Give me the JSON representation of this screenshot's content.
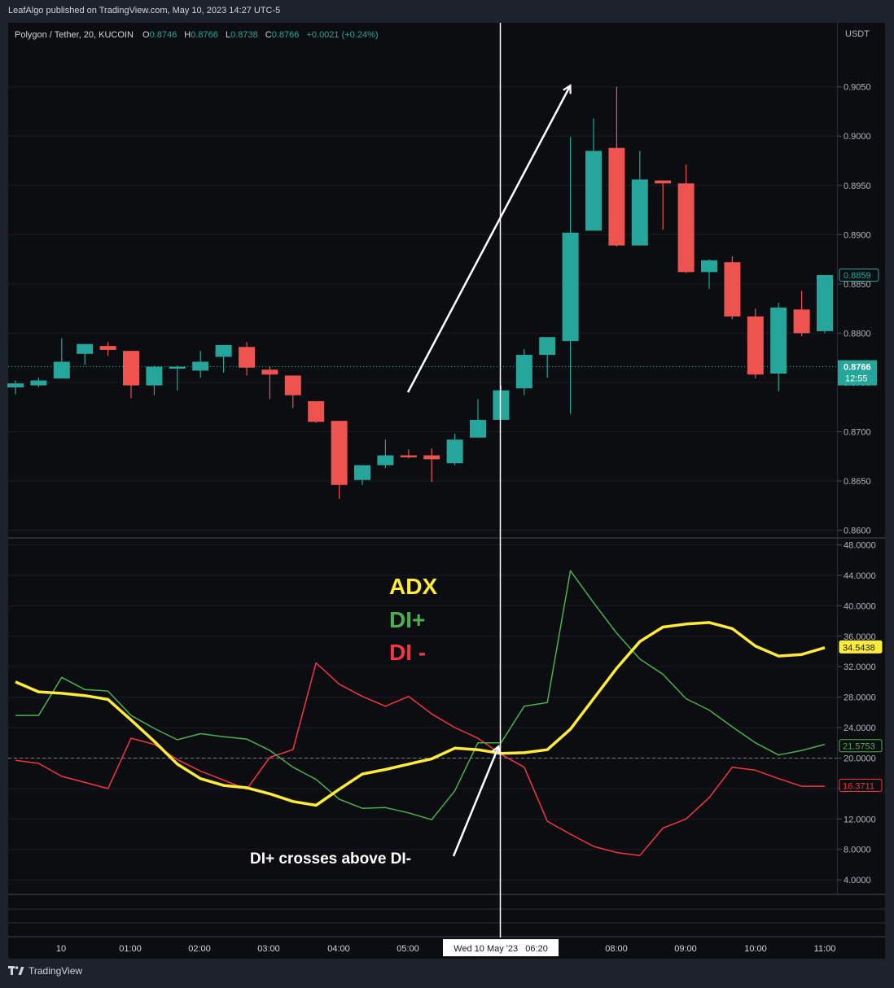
{
  "header": {
    "published": "LeafAlgo published on TradingView.com, May 10, 2023 14:27 UTC-5"
  },
  "footer": {
    "brand": "TradingView"
  },
  "colors": {
    "up": "#26a69a",
    "down": "#ef5350",
    "adx": "#ffeb3b",
    "di_plus": "#4caf50",
    "di_minus": "#f23645",
    "bg": "#0c0d11",
    "axis_text": "#b2b5be"
  },
  "legend": {
    "symbol": "Polygon / Tether, 20, KUCOIN",
    "o_label": "O",
    "o": "0.8746",
    "h_label": "H",
    "h": "0.8766",
    "l_label": "L",
    "l": "0.8738",
    "c_label": "C",
    "c": "0.8766",
    "change": "+0.0021 (+0.24%)"
  },
  "annotations": {
    "adx": "ADX",
    "di_plus": "DI+",
    "di_minus": "DI -",
    "cross": "DI+ crosses above DI-"
  },
  "chart_data": [
    {
      "type": "candlestick",
      "currency": "USDT",
      "ylim": [
        0.8593,
        0.9115
      ],
      "y_ticks": [
        "0.8600",
        "0.8650",
        "0.8700",
        "0.8750",
        "0.8800",
        "0.8850",
        "0.8900",
        "0.8950",
        "0.9000",
        "0.9050"
      ],
      "last_price": "0.8766",
      "countdown": "12:55",
      "hi_price": "0.8859",
      "candles": [
        {
          "o": 0.8745,
          "h": 0.8752,
          "l": 0.8738,
          "c": 0.8749
        },
        {
          "o": 0.8747,
          "h": 0.8755,
          "l": 0.8745,
          "c": 0.8752
        },
        {
          "o": 0.8754,
          "h": 0.8795,
          "l": 0.8754,
          "c": 0.8771
        },
        {
          "o": 0.8779,
          "h": 0.8788,
          "l": 0.8768,
          "c": 0.8789
        },
        {
          "o": 0.8787,
          "h": 0.8791,
          "l": 0.8777,
          "c": 0.8783
        },
        {
          "o": 0.8782,
          "h": 0.8782,
          "l": 0.8734,
          "c": 0.8747
        },
        {
          "o": 0.8747,
          "h": 0.8767,
          "l": 0.8737,
          "c": 0.8766
        },
        {
          "o": 0.8764,
          "h": 0.8767,
          "l": 0.8742,
          "c": 0.8766
        },
        {
          "o": 0.8762,
          "h": 0.8782,
          "l": 0.8755,
          "c": 0.8771
        },
        {
          "o": 0.8776,
          "h": 0.8788,
          "l": 0.876,
          "c": 0.8788
        },
        {
          "o": 0.8786,
          "h": 0.8791,
          "l": 0.8757,
          "c": 0.8765
        },
        {
          "o": 0.8763,
          "h": 0.8766,
          "l": 0.8733,
          "c": 0.8758
        },
        {
          "o": 0.8757,
          "h": 0.8757,
          "l": 0.8724,
          "c": 0.8737
        },
        {
          "o": 0.8731,
          "h": 0.8731,
          "l": 0.8709,
          "c": 0.871
        },
        {
          "o": 0.8711,
          "h": 0.8711,
          "l": 0.8632,
          "c": 0.8646
        },
        {
          "o": 0.8651,
          "h": 0.8666,
          "l": 0.8646,
          "c": 0.8666
        },
        {
          "o": 0.8666,
          "h": 0.8692,
          "l": 0.8663,
          "c": 0.8676
        },
        {
          "o": 0.8676,
          "h": 0.8682,
          "l": 0.8673,
          "c": 0.8674
        },
        {
          "o": 0.8676,
          "h": 0.8683,
          "l": 0.8649,
          "c": 0.8672
        },
        {
          "o": 0.8668,
          "h": 0.8698,
          "l": 0.8666,
          "c": 0.8692
        },
        {
          "o": 0.8694,
          "h": 0.8733,
          "l": 0.8694,
          "c": 0.8712
        },
        {
          "o": 0.8712,
          "h": 0.8747,
          "l": 0.8712,
          "c": 0.8742
        },
        {
          "o": 0.8744,
          "h": 0.8784,
          "l": 0.8737,
          "c": 0.8778
        },
        {
          "o": 0.8778,
          "h": 0.8796,
          "l": 0.8755,
          "c": 0.8796
        },
        {
          "o": 0.8792,
          "h": 0.8999,
          "l": 0.8718,
          "c": 0.8902
        },
        {
          "o": 0.8904,
          "h": 0.9018,
          "l": 0.8904,
          "c": 0.8985
        },
        {
          "o": 0.8988,
          "h": 0.905,
          "l": 0.8888,
          "c": 0.8889
        },
        {
          "o": 0.8889,
          "h": 0.8985,
          "l": 0.8889,
          "c": 0.8956
        },
        {
          "o": 0.8955,
          "h": 0.8955,
          "l": 0.8905,
          "c": 0.8952
        },
        {
          "o": 0.8952,
          "h": 0.8971,
          "l": 0.8861,
          "c": 0.8862
        },
        {
          "o": 0.8862,
          "h": 0.8875,
          "l": 0.8845,
          "c": 0.8874
        },
        {
          "o": 0.8872,
          "h": 0.8878,
          "l": 0.8814,
          "c": 0.8817
        },
        {
          "o": 0.8817,
          "h": 0.8825,
          "l": 0.8754,
          "c": 0.8758
        },
        {
          "o": 0.8759,
          "h": 0.8831,
          "l": 0.8741,
          "c": 0.8826
        },
        {
          "o": 0.8824,
          "h": 0.8843,
          "l": 0.8797,
          "c": 0.88
        },
        {
          "o": 0.8802,
          "h": 0.8858,
          "l": 0.88,
          "c": 0.8859
        }
      ]
    },
    {
      "type": "line",
      "ylim": [
        2.2,
        48.8
      ],
      "y_ticks": [
        "4.0000",
        "8.0000",
        "12.0000",
        "16.0000",
        "20.0000",
        "24.0000",
        "28.0000",
        "32.0000",
        "36.0000",
        "40.0000",
        "44.0000",
        "48.0000"
      ],
      "reference_line": 20,
      "series": [
        {
          "name": "ADX",
          "color": "#ffeb3b",
          "last": "34.5438",
          "values": [
            30.0,
            28.7,
            28.5,
            28.2,
            27.7,
            25.0,
            22.2,
            19.2,
            17.3,
            16.4,
            16.1,
            15.3,
            14.3,
            13.8,
            15.9,
            17.9,
            18.5,
            19.2,
            19.9,
            21.3,
            21.1,
            20.6,
            20.7,
            21.1,
            23.8,
            27.8,
            31.8,
            35.3,
            37.2,
            37.6,
            37.8,
            37.0,
            34.7,
            33.4,
            33.6,
            34.5
          ]
        },
        {
          "name": "DI+",
          "color": "#4caf50",
          "last": "21.5753",
          "values": [
            25.6,
            25.6,
            30.6,
            29.0,
            28.8,
            25.6,
            23.9,
            22.4,
            23.2,
            22.8,
            22.5,
            21.0,
            18.8,
            17.2,
            14.6,
            13.4,
            13.5,
            12.8,
            11.9,
            15.7,
            22.0,
            22.0,
            26.8,
            27.3,
            44.6,
            40.4,
            36.4,
            33.0,
            31.0,
            27.8,
            26.3,
            24.1,
            22.0,
            20.4,
            21.0,
            21.8
          ]
        },
        {
          "name": "DI-",
          "color": "#f23645",
          "last": "16.3711",
          "values": [
            19.7,
            19.3,
            17.6,
            16.8,
            16.0,
            22.6,
            21.8,
            19.8,
            18.3,
            17.1,
            15.9,
            20.1,
            21.1,
            32.5,
            29.7,
            28.1,
            26.8,
            28.1,
            25.8,
            24.0,
            22.6,
            20.5,
            18.8,
            11.7,
            10.0,
            8.4,
            7.6,
            7.2,
            10.8,
            12.0,
            14.8,
            18.8,
            18.4,
            17.3,
            16.3,
            16.3
          ]
        }
      ]
    }
  ],
  "x_axis": {
    "labels": [
      "10",
      "01:00",
      "02:00",
      "03:00",
      "04:00",
      "05:00",
      "08:00",
      "09:00",
      "10:00",
      "11:00"
    ],
    "crosshair_label": "Wed 10 May '23   06:20"
  }
}
